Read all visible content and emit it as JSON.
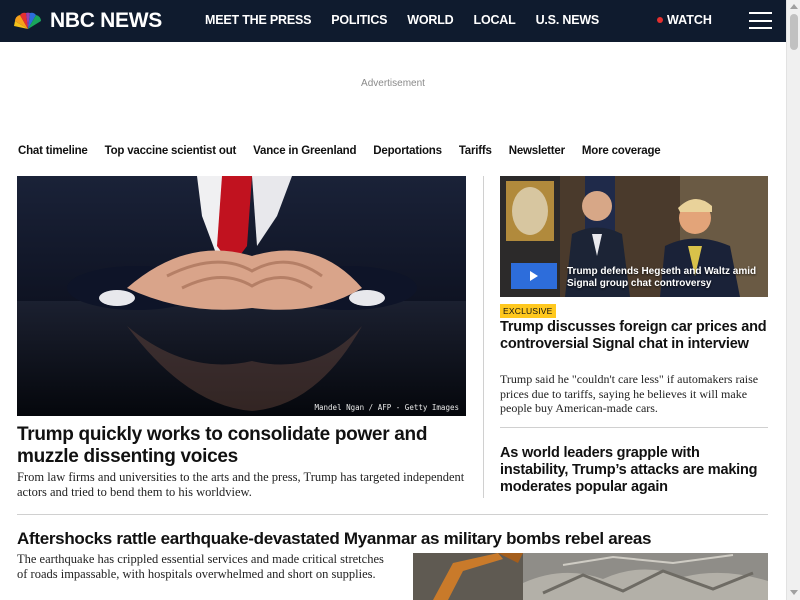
{
  "header": {
    "logo_text": "NBC NEWS",
    "nav": [
      "MEET THE PRESS",
      "POLITICS",
      "WORLD",
      "LOCAL",
      "U.S. NEWS"
    ],
    "watch_label": "WATCH",
    "colors": {
      "header_bg": "#0f1b2e",
      "live_dot": "#e4302f"
    }
  },
  "ad_label": "Advertisement",
  "trending": [
    "Chat timeline",
    "Top vaccine scientist out",
    "Vance in Greenland",
    "Deportations",
    "Tariffs",
    "Newsletter",
    "More coverage"
  ],
  "lead": {
    "image_credit": "Mandel Ngan / AFP - Getty Images",
    "title": "Trump quickly works to consolidate power and muzzle dissenting voices",
    "description": "From law firms and universities to the arts and the press, Trump has targeted independent actors and tried to bend them to his worldview."
  },
  "video": {
    "caption": "Trump defends Hegseth and Waltz amid Signal group chat controversy",
    "play_color": "#2d6ddb"
  },
  "right1": {
    "badge": "EXCLUSIVE",
    "badge_color": "#ffc81e",
    "title": "Trump discusses foreign car prices and controversial Signal chat in interview",
    "description": "Trump said he \"couldn't care less\" if automakers raise prices due to tariffs, saying he believes it will make people buy American-made cars."
  },
  "right2": {
    "title": "As world leaders grapple with instability, Trump’s attacks are making moderates popular again"
  },
  "bottom": {
    "title": "Aftershocks rattle earthquake-devastated Myanmar as military bombs rebel areas",
    "description": "The earthquake has crippled essential services and made critical stretches of roads impassable, with hospitals overwhelmed and short on supplies."
  }
}
